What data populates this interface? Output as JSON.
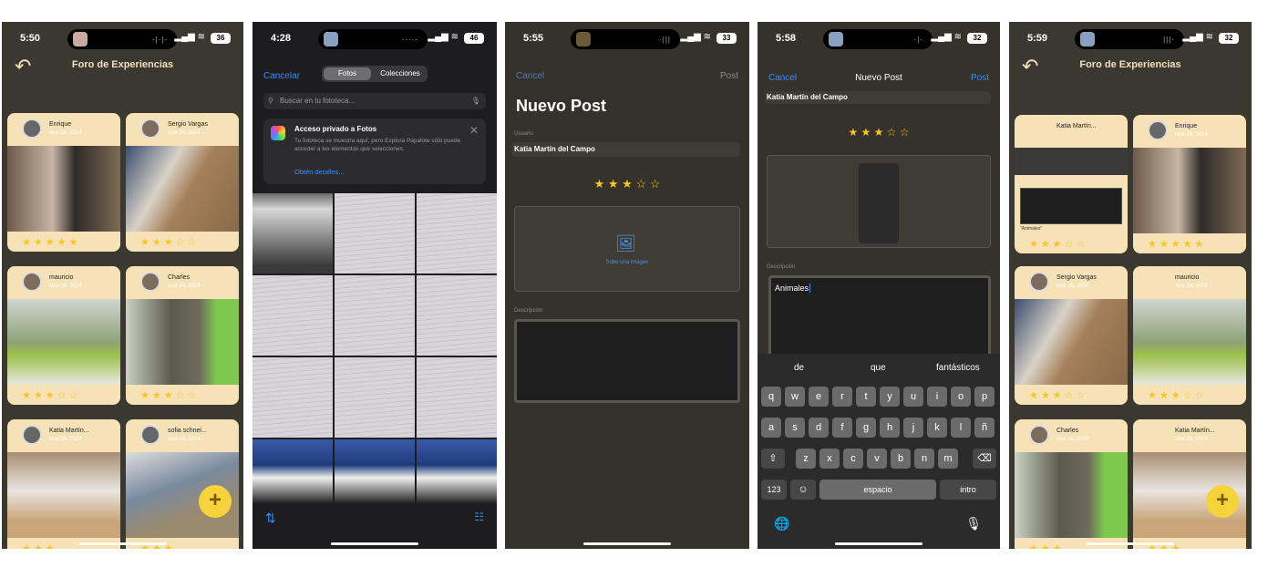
{
  "screens": {
    "s1": {
      "time": "5:50",
      "battery": "36",
      "title": "Foro de Experiencias",
      "cards": [
        {
          "name": "Enrique",
          "date": "Nov 26, 2024",
          "stars": "★★★★★"
        },
        {
          "name": "Sergio Vargas",
          "date": "Nov 26, 2024",
          "stars": "★★★☆☆"
        },
        {
          "name": "mauricio",
          "date": "Nov 26, 2024",
          "stars": "★★★☆☆"
        },
        {
          "name": "Charles",
          "date": "Nov 26, 2024",
          "stars": "★★★☆☆"
        },
        {
          "name": "Katia Martín...",
          "date": "Nov 26, 2024",
          "stars": "★★★"
        },
        {
          "name": "sofia schnei...",
          "date": "Nov 26, 2024",
          "stars": "★★★"
        }
      ]
    },
    "s2": {
      "time": "4:28",
      "battery": "46",
      "cancel": "Cancelar",
      "tab_photos": "Fotos",
      "tab_collections": "Colecciones",
      "search_placeholder": "Buscar en tu fototeca...",
      "info_title": "Acceso privado a Fotos",
      "info_body": "Tu fototeca se muestra aquí, pero Explora Papalote sólo puede acceder a los elementos que selecciones.",
      "info_link": "Obtén detalles..."
    },
    "s3": {
      "time": "5:55",
      "battery": "33",
      "cancel": "Cancel",
      "post": "Post",
      "heading": "Nuevo Post",
      "user_label": "Usuario",
      "user_value": "Katia Martín del Campo",
      "stars": "★ ★ ★ ☆ ☆",
      "upload": "Sube una imagen",
      "desc_label": "Descripción"
    },
    "s4": {
      "time": "5:58",
      "battery": "32",
      "cancel": "Cancel",
      "title": "Nuevo Post",
      "post": "Post",
      "user_value": "Katia Martín del Campo",
      "stars": "★ ★ ★ ☆ ☆",
      "desc_label": "Descripción",
      "desc_value": "Animales",
      "suggestions": [
        "de",
        "que",
        "fantásticos"
      ],
      "row1": [
        "q",
        "w",
        "e",
        "r",
        "t",
        "y",
        "u",
        "i",
        "o",
        "p"
      ],
      "row2": [
        "a",
        "s",
        "d",
        "f",
        "g",
        "h",
        "j",
        "k",
        "l",
        "ñ"
      ],
      "row3": [
        "z",
        "x",
        "c",
        "v",
        "b",
        "n",
        "m"
      ],
      "key_123": "123",
      "key_space": "espacio",
      "key_return": "intro"
    },
    "s5": {
      "time": "5:59",
      "battery": "32",
      "title": "Foro de Experiencias",
      "cards": [
        {
          "name": "Katia Martín...",
          "date": "",
          "stars": "★★★☆☆",
          "caption": "\"Animales\""
        },
        {
          "name": "Enrique",
          "date": "Nov 26, 2024",
          "stars": "★★★★★"
        },
        {
          "name": "Sergio Vargas",
          "date": "Nov 26, 2024",
          "stars": "★★★☆☆"
        },
        {
          "name": "mauricio",
          "date": "Nov 26, 2024",
          "stars": "★★★☆☆"
        },
        {
          "name": "Charles",
          "date": "Nov 26, 2024",
          "stars": "★★★"
        },
        {
          "name": "Katia Martín...",
          "date": "Nov 26, 2024",
          "stars": "★★★"
        }
      ]
    }
  },
  "colors": {
    "cream": "#f7e2b7",
    "accent": "#f6d33c",
    "link": "#3b8bf5",
    "star": "#f6c624"
  }
}
